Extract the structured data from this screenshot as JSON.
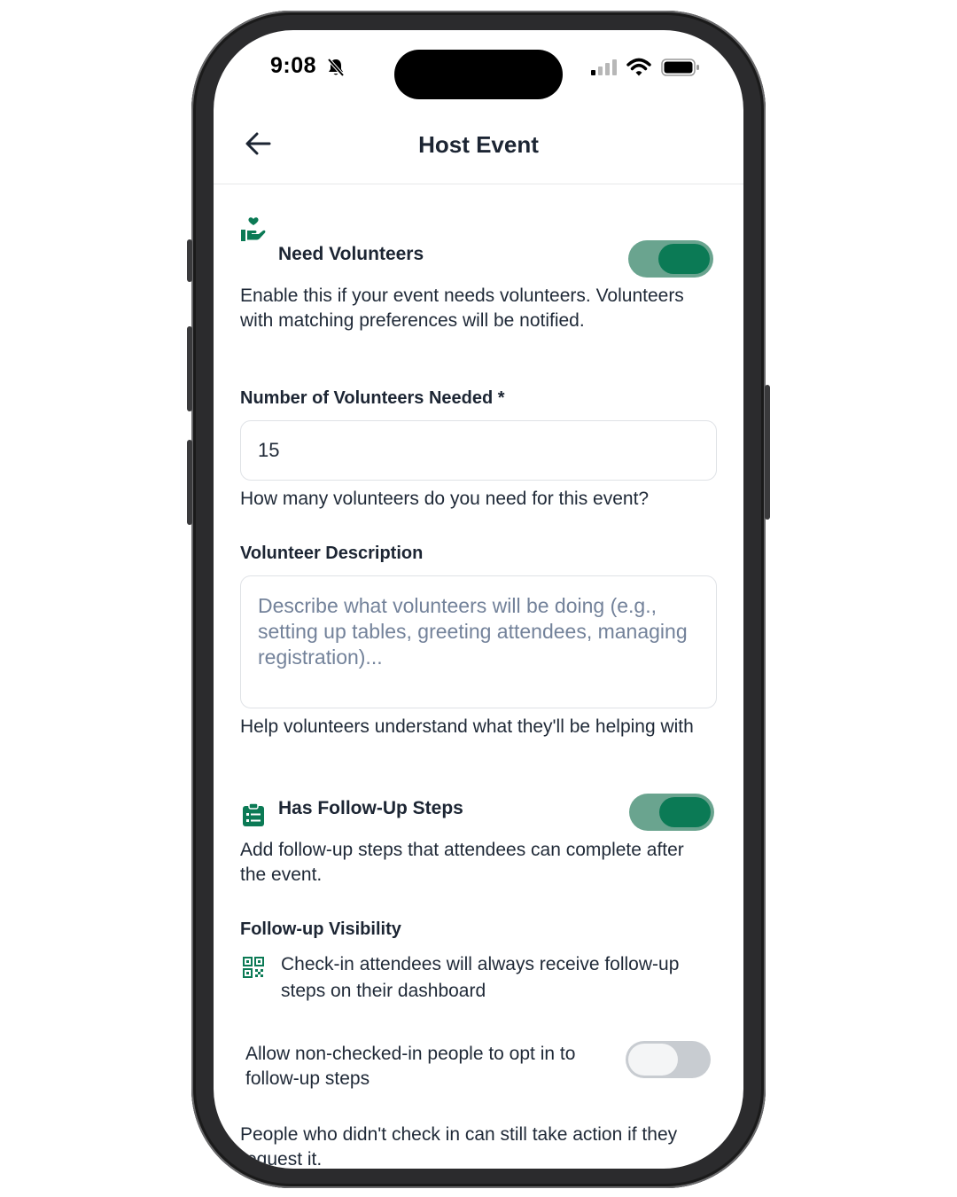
{
  "status_bar": {
    "time": "9:08"
  },
  "header": {
    "title": "Host Event"
  },
  "volunteers": {
    "title": "Need Volunteers",
    "enabled": true,
    "description": "Enable this if your event needs volunteers. Volunteers with matching preferences will be notified.",
    "count_label": "Number of Volunteers Needed *",
    "count_value": "15",
    "count_help": "How many volunteers do you need for this event?",
    "desc_label": "Volunteer Description",
    "desc_placeholder": "Describe what volunteers will be doing (e.g., setting up tables, greeting attendees, managing registration)...",
    "desc_help": "Help volunteers understand what they'll be helping with"
  },
  "follow_up": {
    "title": "Has Follow-Up Steps",
    "enabled": true,
    "description": "Add follow-up steps that attendees can complete after the event.",
    "visibility_label": "Follow-up Visibility",
    "checkin_note": "Check-in attendees will always receive follow-up steps on their dashboard",
    "optin_label": "Allow non-checked-in people to opt in to follow-up steps",
    "optin_enabled": false,
    "optin_help": "People who didn't check in can still take action if they request it."
  },
  "colors": {
    "accent": "#0b7a55",
    "toggle_track_on": "#6aa48f",
    "toggle_track_off": "#c8ccd1",
    "text": "#1c2533"
  },
  "icons": [
    "bell-slash-icon",
    "signal-icon",
    "wifi-icon",
    "battery-icon",
    "back-arrow-icon",
    "volunteer-hand-heart-icon",
    "clipboard-list-icon",
    "qr-code-icon"
  ]
}
